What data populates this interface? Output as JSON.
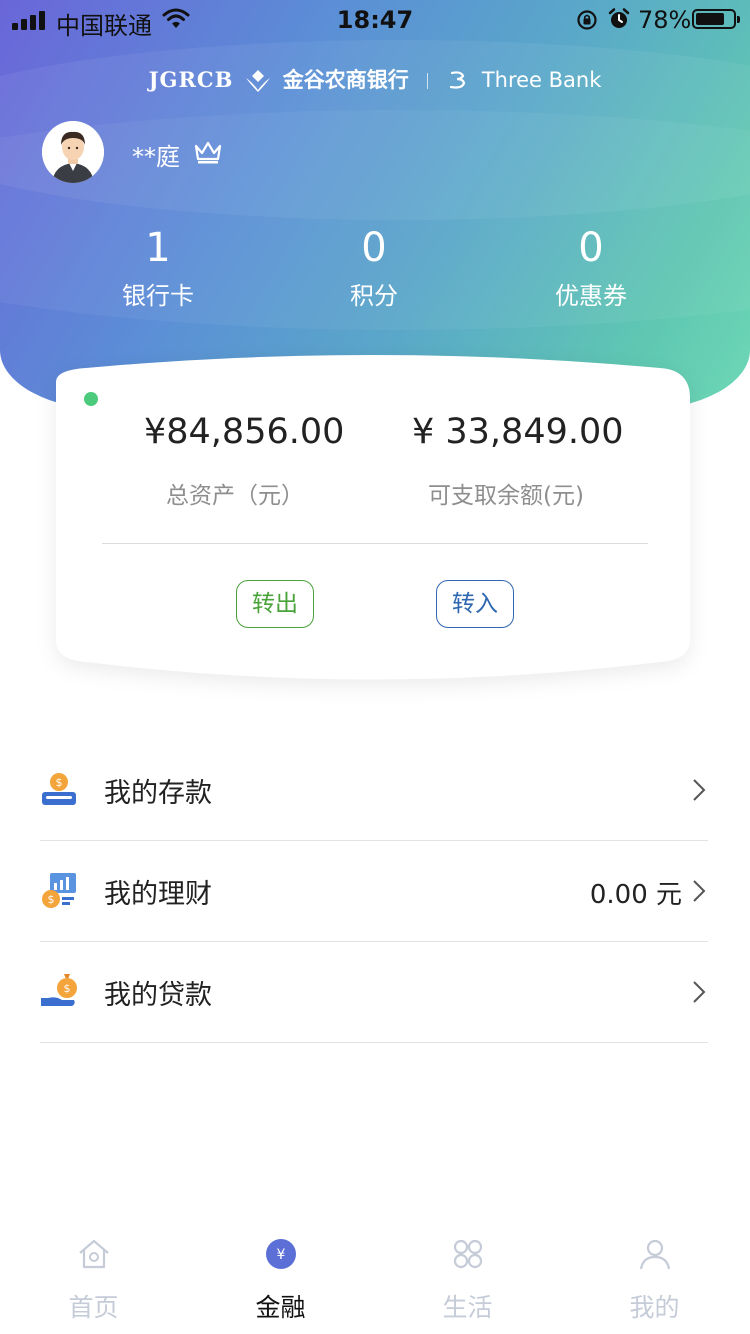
{
  "status_bar": {
    "carrier": "中国联通",
    "time": "18:47",
    "battery_percent": "78%",
    "battery_level": 0.78
  },
  "brand": {
    "code": "JGRCB",
    "name_cn": "金谷农商银行",
    "name_en": "Three Bank"
  },
  "user": {
    "name": "**庭"
  },
  "stats": [
    {
      "value": "1",
      "label": "银行卡"
    },
    {
      "value": "0",
      "label": "积分"
    },
    {
      "value": "0",
      "label": "优惠券"
    }
  ],
  "account_card": {
    "total_assets": "¥84,856.00",
    "total_assets_label": "总资产（元）",
    "available_balance": "¥ 33,849.00",
    "available_balance_label": "可支取余额(元)",
    "transfer_out_label": "转出",
    "transfer_in_label": "转入"
  },
  "menu": [
    {
      "label": "我的存款",
      "value": "",
      "icon": "deposit-icon"
    },
    {
      "label": "我的理财",
      "value": "0.00 元",
      "icon": "wealth-icon"
    },
    {
      "label": "我的贷款",
      "value": "",
      "icon": "loan-icon"
    }
  ],
  "tabbar": [
    {
      "label": "首页",
      "icon": "home-icon",
      "active": false
    },
    {
      "label": "金融",
      "icon": "finance-icon",
      "active": true
    },
    {
      "label": "生活",
      "icon": "life-icon",
      "active": false
    },
    {
      "label": "我的",
      "icon": "profile-icon",
      "active": false
    }
  ],
  "colors": {
    "accent_active": "#5b6fd6",
    "transfer_out": "#4aa33a",
    "transfer_in": "#2e67b0",
    "online_dot": "#4ccb7c"
  }
}
